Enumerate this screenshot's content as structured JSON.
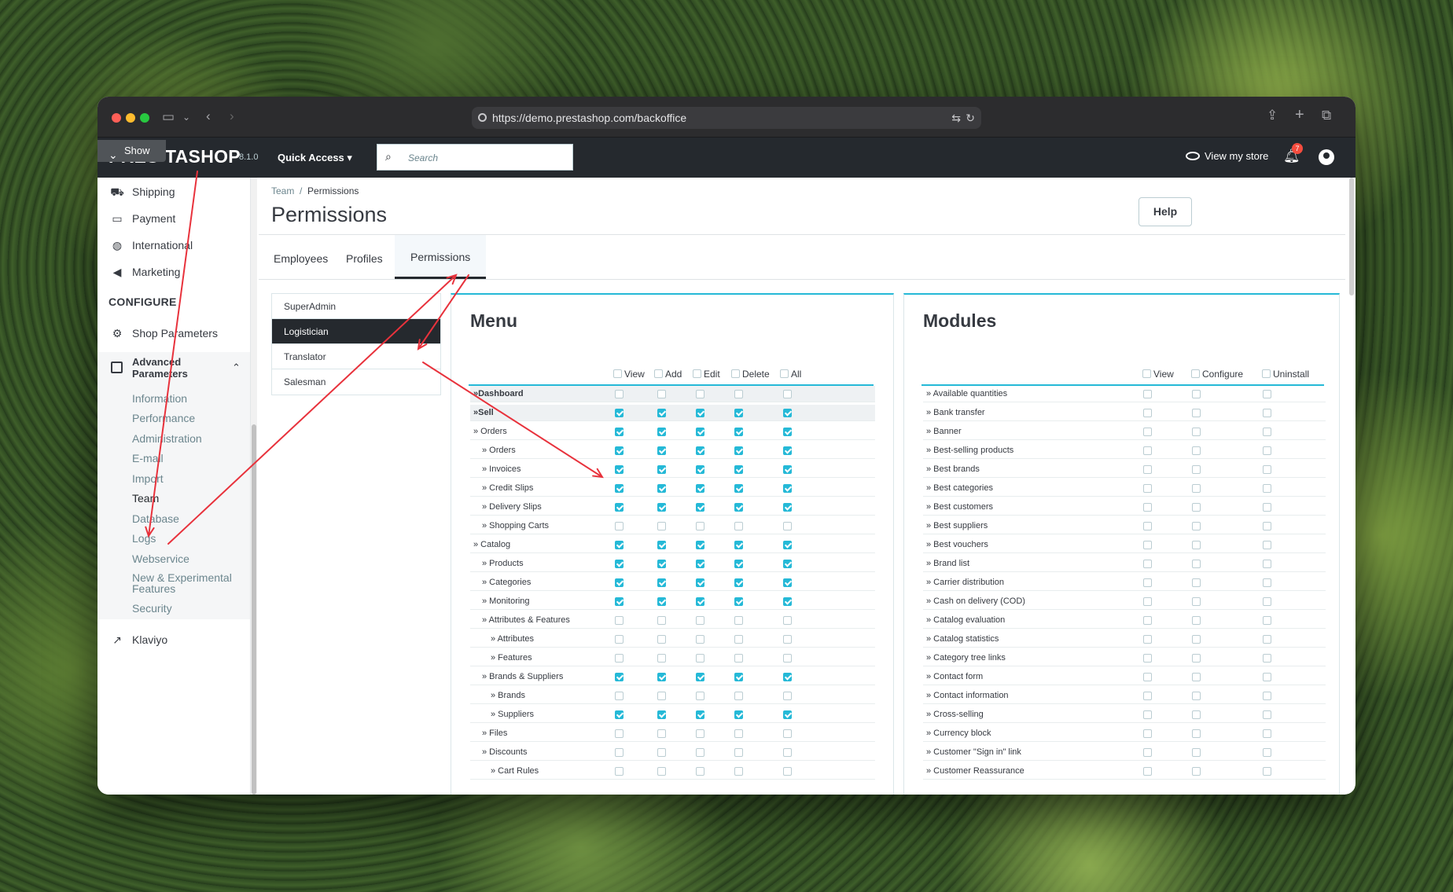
{
  "browser": {
    "url": "https://demo.prestashop.com/backoffice"
  },
  "topbar": {
    "show_label": "Show",
    "logo_left": "PRES",
    "logo_right": "TASHOP",
    "version": "8.1.0",
    "quick_access": "Quick Access ▾",
    "search_placeholder": "Search",
    "view_store": "View my store",
    "notification_count": "7"
  },
  "sidebar": {
    "items": [
      {
        "label": "Shipping",
        "icon": "truck-icon"
      },
      {
        "label": "Payment",
        "icon": "card-icon"
      },
      {
        "label": "International",
        "icon": "globe-icon"
      },
      {
        "label": "Marketing",
        "icon": "megaphone-icon"
      }
    ],
    "section": "CONFIGURE",
    "shop_parameters": "Shop Parameters",
    "advanced": "Advanced Parameters",
    "sub_items": [
      "Information",
      "Performance",
      "Administration",
      "E-mail",
      "Import",
      "Team",
      "Database",
      "Logs",
      "Webservice",
      "New & Experimental Features",
      "Security"
    ],
    "klaviyo": "Klaviyo"
  },
  "breadcrumb": {
    "parent": "Team",
    "sep": "/",
    "current": "Permissions"
  },
  "page_title": "Permissions",
  "help_label": "Help",
  "tabs": [
    "Employees",
    "Profiles",
    "Permissions"
  ],
  "profiles": [
    "SuperAdmin",
    "Logistician",
    "Translator",
    "Salesman"
  ],
  "menu": {
    "title": "Menu",
    "columns": [
      "View",
      "Add",
      "Edit",
      "Delete",
      "All"
    ],
    "rows": [
      {
        "label": "»Dashboard",
        "level": 0,
        "checked": false,
        "top": true
      },
      {
        "label": "»Sell",
        "level": 0,
        "checked": true,
        "top": true
      },
      {
        "label": "» Orders",
        "level": 0,
        "checked": true
      },
      {
        "label": "» Orders",
        "level": 1,
        "checked": true
      },
      {
        "label": "» Invoices",
        "level": 1,
        "checked": true
      },
      {
        "label": "» Credit Slips",
        "level": 1,
        "checked": true
      },
      {
        "label": "» Delivery Slips",
        "level": 1,
        "checked": true
      },
      {
        "label": "» Shopping Carts",
        "level": 1,
        "checked": false
      },
      {
        "label": "» Catalog",
        "level": 0,
        "checked": true
      },
      {
        "label": "» Products",
        "level": 1,
        "checked": true
      },
      {
        "label": "» Categories",
        "level": 1,
        "checked": true
      },
      {
        "label": "» Monitoring",
        "level": 1,
        "checked": true
      },
      {
        "label": "» Attributes & Features",
        "level": 1,
        "checked": false
      },
      {
        "label": "» Attributes",
        "level": 2,
        "checked": false
      },
      {
        "label": "» Features",
        "level": 2,
        "checked": false
      },
      {
        "label": "» Brands & Suppliers",
        "level": 1,
        "checked": true
      },
      {
        "label": "» Brands",
        "level": 2,
        "checked": false
      },
      {
        "label": "» Suppliers",
        "level": 2,
        "checked": true
      },
      {
        "label": "» Files",
        "level": 1,
        "checked": false
      },
      {
        "label": "» Discounts",
        "level": 1,
        "checked": false
      },
      {
        "label": "» Cart Rules",
        "level": 2,
        "checked": false
      }
    ]
  },
  "modules": {
    "title": "Modules",
    "columns": [
      "View",
      "Configure",
      "Uninstall"
    ],
    "rows": [
      "» Available quantities",
      "» Bank transfer",
      "» Banner",
      "» Best-selling products",
      "» Best brands",
      "» Best categories",
      "» Best customers",
      "» Best suppliers",
      "» Best vouchers",
      "» Brand list",
      "» Carrier distribution",
      "» Cash on delivery (COD)",
      "» Catalog evaluation",
      "» Catalog statistics",
      "» Category tree links",
      "» Contact form",
      "» Contact information",
      "» Cross-selling",
      "» Currency block",
      "» Customer \"Sign in\" link",
      "» Customer Reassurance"
    ]
  },
  "colors": {
    "accent": "#25b9d7",
    "annotation": "#e8323c",
    "dark": "#25292e"
  }
}
